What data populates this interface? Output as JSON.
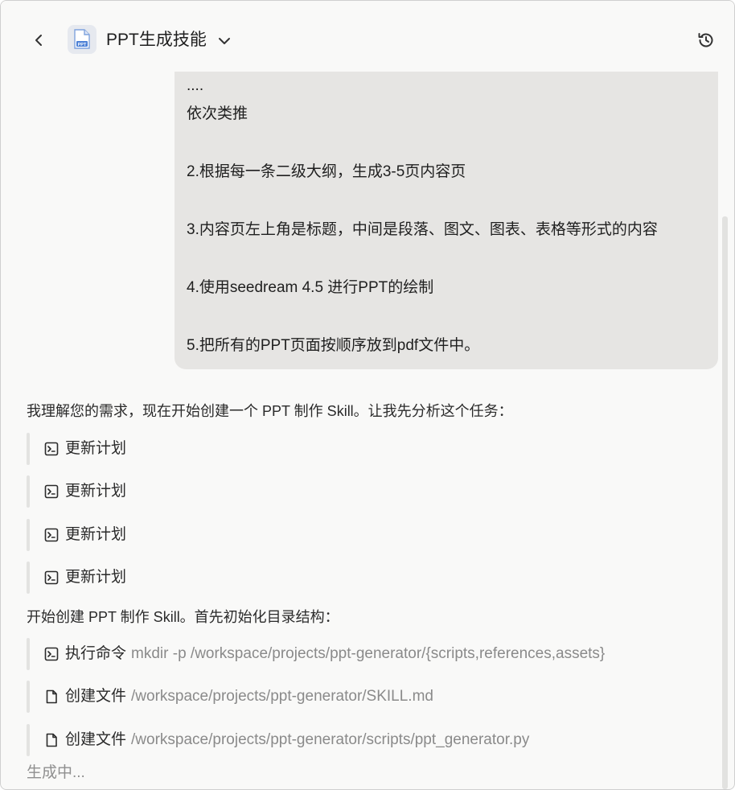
{
  "header": {
    "title": "PPT生成技能",
    "app_icon_label": "PPT"
  },
  "user_message": {
    "lines": [
      "....",
      "依次类推",
      "2.根据每一条二级大纲，生成3-5页内容页",
      "3.内容页左上角是标题，中间是段落、图文、图表、表格等形式的内容",
      "4.使用seedream 4.5 进行PPT的绘制",
      "5.把所有的PPT页面按顺序放到pdf文件中。"
    ]
  },
  "assistant": {
    "intro": "我理解您的需求，现在开始创建一个 PPT 制作 Skill。让我先分析这个任务：",
    "plan_items": [
      {
        "label": "更新计划",
        "icon": "terminal-icon"
      },
      {
        "label": "更新计划",
        "icon": "terminal-icon"
      },
      {
        "label": "更新计划",
        "icon": "terminal-icon"
      },
      {
        "label": "更新计划",
        "icon": "terminal-icon"
      }
    ],
    "step_text": "开始创建 PPT 制作 Skill。首先初始化目录结构：",
    "actions": [
      {
        "label": "执行命令",
        "detail": "mkdir -p /workspace/projects/ppt-generator/{scripts,references,assets}",
        "icon": "terminal-icon"
      },
      {
        "label": "创建文件",
        "detail": "/workspace/projects/ppt-generator/SKILL.md",
        "icon": "file-icon"
      },
      {
        "label": "创建文件",
        "detail": "/workspace/projects/ppt-generator/scripts/ppt_generator.py",
        "icon": "file-icon"
      }
    ],
    "status": "生成中..."
  },
  "colors": {
    "background": "#f9f9f8",
    "user_bubble": "#e6e5e3",
    "muted_text": "#8a8a8a",
    "icon_blue": "#4a7fd6"
  }
}
